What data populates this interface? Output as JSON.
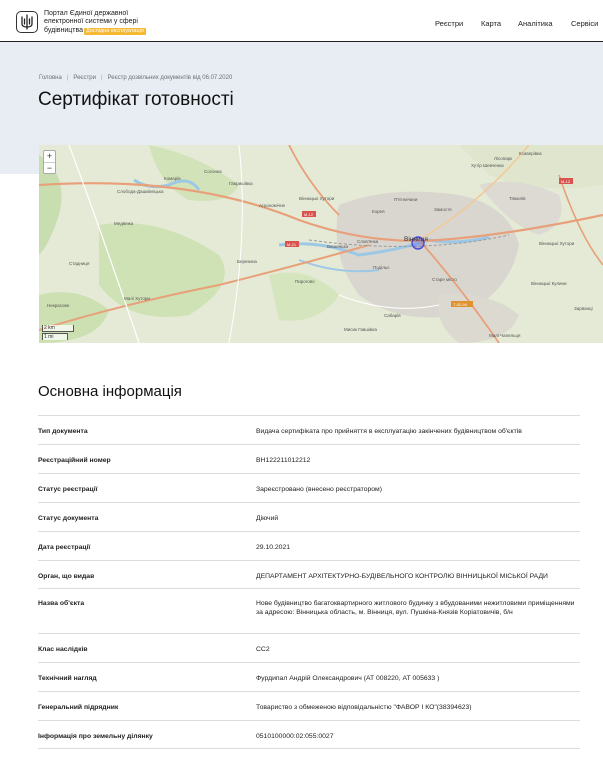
{
  "header": {
    "brand_line1": "Портал Єдиної державної",
    "brand_line2": "електронної системи у сфері",
    "brand_line3": "будівництва",
    "beta_badge": "Дослідна експлуатація",
    "nav": [
      "Реєстри",
      "Карта",
      "Аналітика",
      "Сервіси"
    ],
    "logo_icon": "trident-icon"
  },
  "breadcrumb": [
    "Головна",
    "Реєстри",
    "Реєстр дозвільних документів від 06.07.2020"
  ],
  "page_title": "Сертифікат готовності",
  "map": {
    "zoom_in": "+",
    "zoom_out": "−",
    "scale_km": "2 km",
    "scale_mi": "1 mi",
    "labels": [
      "Комарів",
      "Сосонка",
      "Слобода-Дашківецька",
      "Медвежа",
      "Гавришівка",
      "Вінницькі Хутори",
      "Березина",
      "Вінниця",
      "Вишенька",
      "Старе місто",
      "Подільє",
      "Пирогово",
      "Сабарів",
      "Некрасове",
      "Малі Хутори",
      "Агрономічне",
      "Стадниця",
      "Лісопарк",
      "Ксаверівка",
      "Тяжилів",
      "Хутір Шевченка",
      "Вінницькі Хутори",
      "Мисик Гавшівка",
      "Замостя",
      "П'ятничани",
      "Слов'янка",
      "Корея",
      "Вінницькі Кулини",
      "Зарванці",
      "Малі Чапельця"
    ],
    "road_labels": [
      "М-12",
      "М-21",
      "М-12",
      "Т-02-94"
    ]
  },
  "section_title": "Основна інформація",
  "info": [
    {
      "label": "Тип документа",
      "value": "Видача сертифіката про прийняття в експлуатацію закінчених будівництвом об'єктів"
    },
    {
      "label": "Реєстраційний номер",
      "value": "ВН122211012212"
    },
    {
      "label": "Статус реєстрації",
      "value": "Зареєстровано (внесено реєстратором)"
    },
    {
      "label": "Статус документа",
      "value": "Діючий"
    },
    {
      "label": "Дата реєстрації",
      "value": "29.10.2021"
    },
    {
      "label": "Орган, що видав",
      "value": "ДЕПАРТАМЕНТ АРХІТЕКТУРНО-БУДІВЕЛЬНОГО КОНТРОЛЮ ВІННИЦЬКОЇ МІСЬКОЇ РАДИ"
    },
    {
      "label": "Назва об'єкта",
      "value": "Нове будівництво багатоквартирного житлового будинку з вбудованими нежитловими приміщеннями за адресою: Вінницька область, м. Вінниця, вул. Пушкіна-Князів Коріатовичів, б/н"
    },
    {
      "label": "Клас наслідків",
      "value": "СС2"
    },
    {
      "label": "Технічний нагляд",
      "value": "Фурдипал Андрій Олександрович (АТ 008220, АТ 005633 )"
    },
    {
      "label": "Генеральний підрядник",
      "value": "Товариство з обмеженою відповідальністю \"ФАВОР І КО\"(38394623)"
    },
    {
      "label": "Інформація про земельну ділянку",
      "value": "0510100000:02:055:0027"
    }
  ],
  "colors": {
    "hero_bg": "#e8edf4",
    "beta_badge": "#f5b833",
    "map_marker": "#5a5de0"
  }
}
